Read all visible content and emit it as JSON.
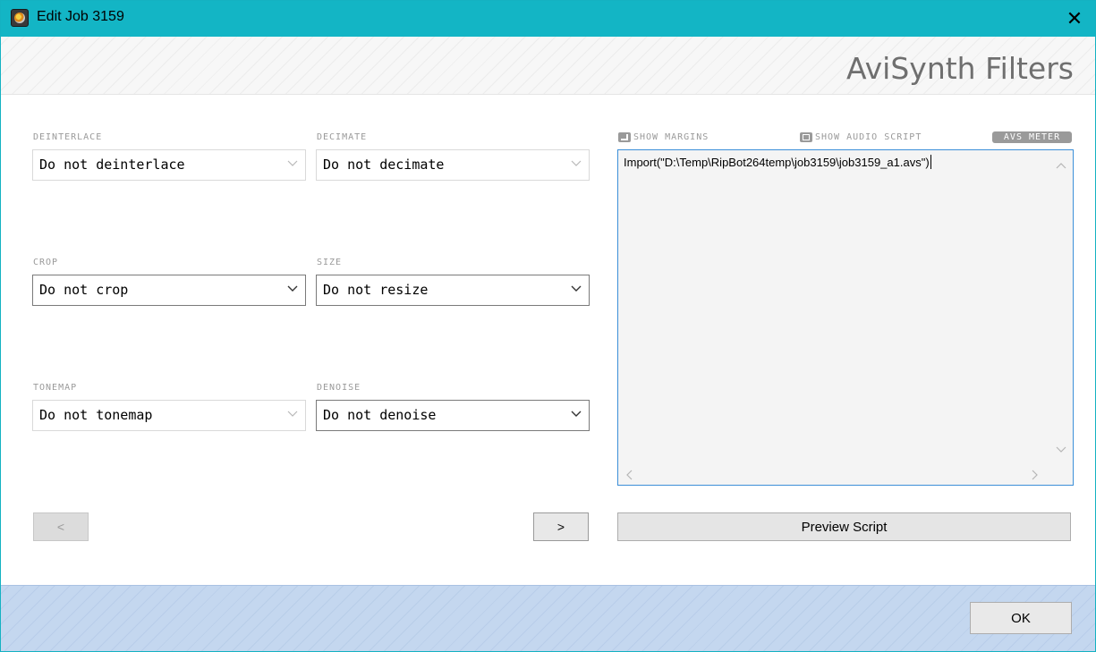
{
  "window": {
    "title": "Edit Job 3159",
    "close_glyph": "✕"
  },
  "header": {
    "title": "AviSynth Filters"
  },
  "filters": {
    "deinterlace": {
      "label": "DEINTERLACE",
      "value": "Do not deinterlace"
    },
    "decimate": {
      "label": "DECIMATE",
      "value": "Do not decimate"
    },
    "crop": {
      "label": "CROP",
      "value": "Do not crop"
    },
    "size": {
      "label": "SIZE",
      "value": "Do not resize"
    },
    "tonemap": {
      "label": "TONEMAP",
      "value": "Do not tonemap"
    },
    "denoise": {
      "label": "DENOISE",
      "value": "Do not denoise"
    }
  },
  "navigation": {
    "prev_label": "<",
    "next_label": ">"
  },
  "script_panel": {
    "show_margins_label": "SHOW MARGINS",
    "show_audio_script_label": "SHOW AUDIO SCRIPT",
    "avs_meter_label": "AVS METER",
    "script_text": "Import(\"D:\\Temp\\RipBot264temp\\job3159\\job3159_a1.avs\")",
    "preview_label": "Preview Script"
  },
  "footer": {
    "ok_label": "OK"
  },
  "colors": {
    "titlebar": "#13b5c5",
    "editor_border": "#3c8fd8",
    "footer_band": "#c4d7ef"
  },
  "icons": {
    "app": "app-icon",
    "close": "close-icon",
    "dropdown": "chevron-down-icon",
    "margins": "margins-icon",
    "audio_script": "audio-script-icon",
    "scroll_up": "chevron-up-icon",
    "scroll_down": "chevron-down-icon",
    "scroll_left": "chevron-left-icon",
    "scroll_right": "chevron-right-icon"
  }
}
